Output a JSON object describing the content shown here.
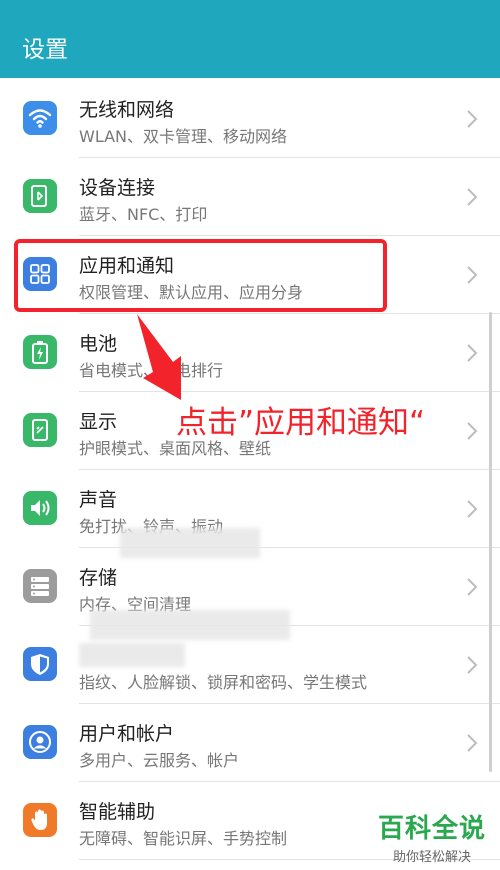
{
  "header": {
    "title": "设置"
  },
  "items": [
    {
      "title": "无线和网络",
      "subtitle": "WLAN、双卡管理、移动网络",
      "icon": "wifi-icon",
      "color": "#3d8ee8"
    },
    {
      "title": "设备连接",
      "subtitle": "蓝牙、NFC、打印",
      "icon": "device-connect-icon",
      "color": "#39b86a"
    },
    {
      "title": "应用和通知",
      "subtitle": "权限管理、默认应用、应用分身",
      "icon": "apps-grid-icon",
      "color": "#3d7fe0"
    },
    {
      "title": "电池",
      "subtitle": "省电模式、耗电排行",
      "icon": "battery-icon",
      "color": "#39b86a"
    },
    {
      "title": "显示",
      "subtitle": "护眼模式、桌面风格、壁纸",
      "icon": "display-icon",
      "color": "#39b86a"
    },
    {
      "title": "声音",
      "subtitle": "免打扰、铃声、振动",
      "icon": "speaker-icon",
      "color": "#39b86a"
    },
    {
      "title": "存储",
      "subtitle": "内存、空间清理",
      "icon": "storage-icon",
      "color": "#9c9c9c"
    },
    {
      "title": "",
      "subtitle": "指纹、人脸解锁、锁屏和密码、学生模式",
      "icon": "shield-icon",
      "color": "#3d7fe0"
    },
    {
      "title": "用户和帐户",
      "subtitle": "多用户、云服务、帐户",
      "icon": "user-icon",
      "color": "#3d7fe0"
    },
    {
      "title": "智能辅助",
      "subtitle": "无障碍、智能识屏、手势控制",
      "icon": "hand-icon",
      "color": "#f07a2a"
    }
  ],
  "annotation": {
    "text": "点击”应用和通知“"
  },
  "watermark": {
    "brand": "百科全说",
    "slogan": "助你轻松解决"
  },
  "colors": {
    "header": "#1fa8bd",
    "highlight": "#f2232b"
  }
}
